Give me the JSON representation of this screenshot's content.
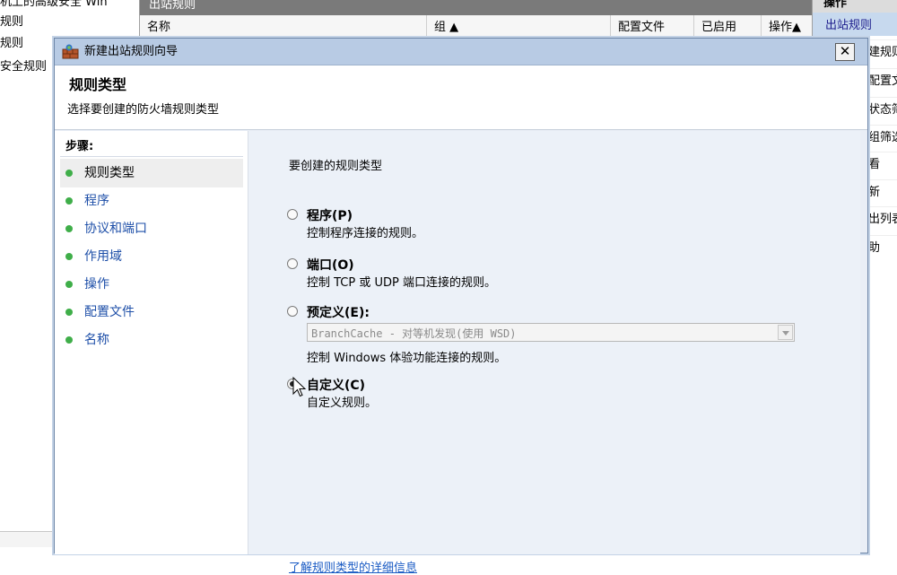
{
  "background": {
    "tree_items": [
      "机上的高级安全 Win",
      "规则",
      "规则",
      "安全规则"
    ],
    "middle_title": "出站规则",
    "columns": [
      "名称",
      "组 ▲",
      "配置文件",
      "已启用",
      "操作▲"
    ],
    "actions_title": "操作",
    "actions_selected": "出站规则",
    "actions": [
      "建规则",
      "配置文",
      "状态筛",
      "组筛选",
      "看",
      "新",
      "出列表",
      "助"
    ]
  },
  "dialog": {
    "title": "新建出站规则向导",
    "close_label": "✕",
    "header_title": "规则类型",
    "header_subtitle": "选择要创建的防火墙规则类型"
  },
  "steps": {
    "title": "步骤:",
    "items": [
      {
        "label": "规则类型",
        "active": true
      },
      {
        "label": "程序",
        "active": false
      },
      {
        "label": "协议和端口",
        "active": false
      },
      {
        "label": "作用域",
        "active": false
      },
      {
        "label": "操作",
        "active": false
      },
      {
        "label": "配置文件",
        "active": false
      },
      {
        "label": "名称",
        "active": false
      }
    ]
  },
  "content": {
    "prompt": "要创建的规则类型",
    "options": [
      {
        "label": "程序(P)",
        "desc": "控制程序连接的规则。",
        "selected": false
      },
      {
        "label": "端口(O)",
        "desc": "控制 TCP 或 UDP 端口连接的规则。",
        "selected": false
      },
      {
        "label": "预定义(E):",
        "combo": "BranchCache - 对等机发现(使用 WSD)",
        "desc": "控制 Windows 体验功能连接的规则。",
        "selected": false
      },
      {
        "label": "自定义(C)",
        "desc": "自定义规则。",
        "selected": true
      }
    ],
    "learn_link": "了解规则类型的详细信息"
  }
}
